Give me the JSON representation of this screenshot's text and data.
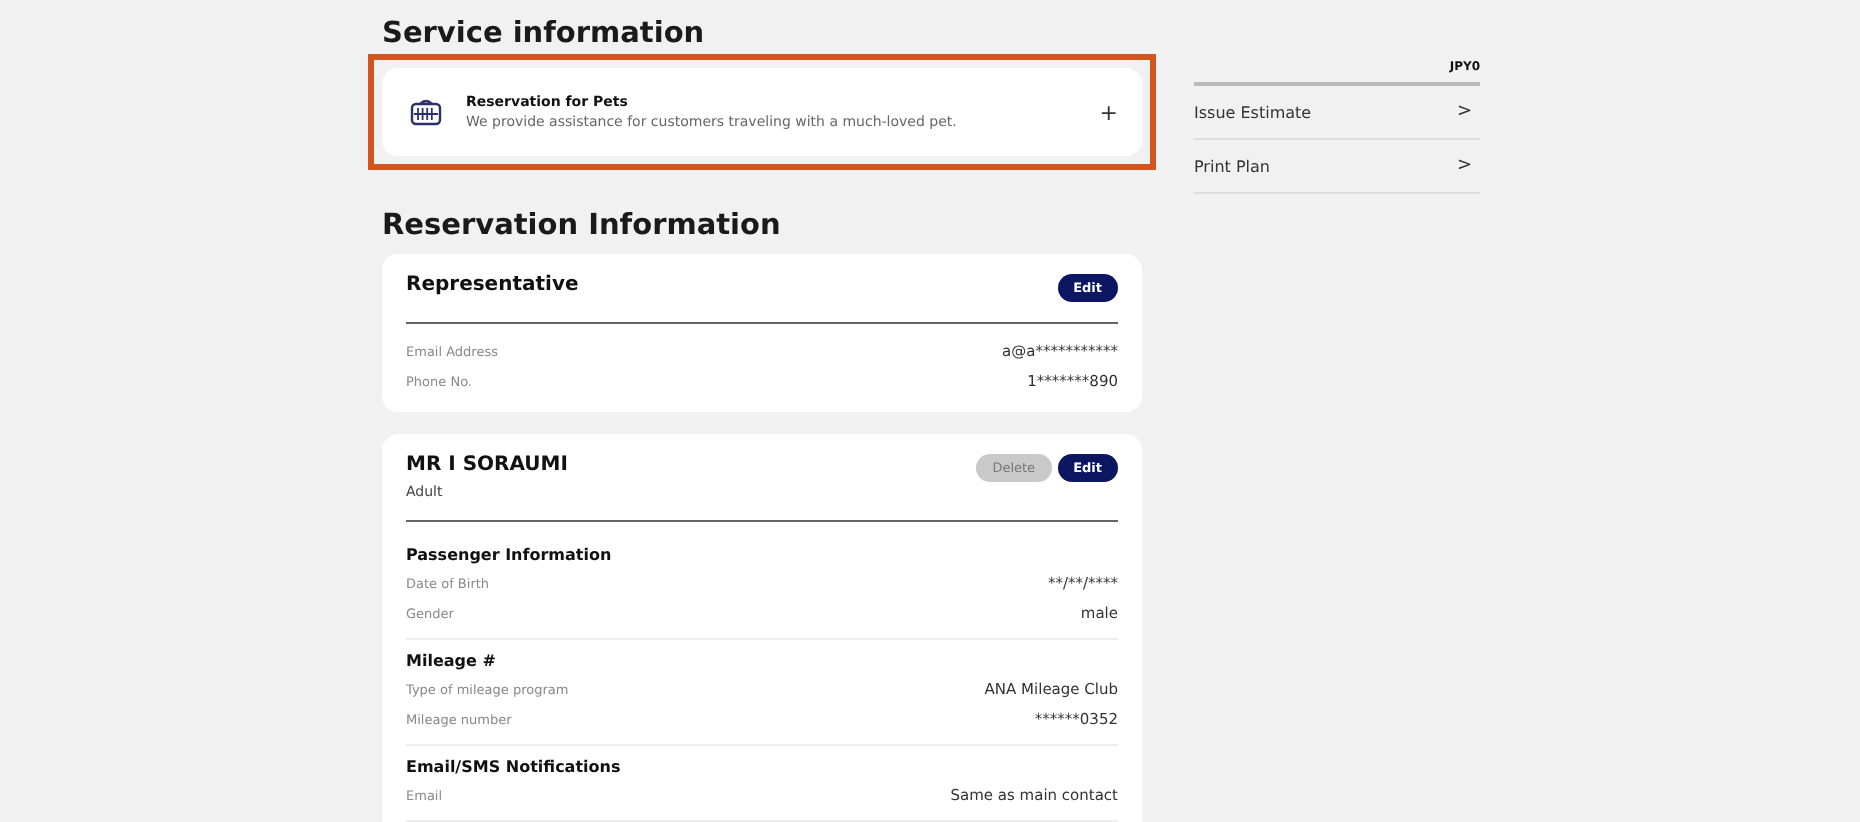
{
  "service_information": {
    "title": "Service information",
    "items": [
      {
        "title": "Reservation for Pets",
        "description": "We provide assistance for customers traveling with a much-loved pet.",
        "action": "+",
        "highlighted": true
      }
    ]
  },
  "sidebar": {
    "service_charge_value": "JPY0",
    "links": [
      {
        "label": "Issue Estimate",
        "arrow": ">"
      },
      {
        "label": "Print Plan",
        "arrow": ">"
      }
    ]
  },
  "reservation_information": {
    "title": "Reservation Information",
    "cards": [
      {
        "title": "Representative",
        "buttons": [
          {
            "kind": "edit",
            "label": "Edit"
          }
        ],
        "sections": [
          {
            "fields": [
              {
                "label": "Email Address",
                "value": "a@a***********"
              },
              {
                "label": "Phone No.",
                "value": "1*******890"
              }
            ]
          }
        ]
      },
      {
        "title": "MR I SORAUMI",
        "subtitle": "Adult",
        "buttons": [
          {
            "kind": "delete",
            "label": "Delete"
          },
          {
            "kind": "edit",
            "label": "Edit"
          }
        ],
        "sections": [
          {
            "heading": "Passenger Information",
            "fields": [
              {
                "label": "Date of Birth",
                "value": "**/**/****"
              },
              {
                "label": "Gender",
                "value": "male"
              }
            ]
          },
          {
            "heading": "Mileage #",
            "fields": [
              {
                "label": "Type of mileage program",
                "value": "ANA Mileage Club"
              },
              {
                "label": "Mileage number",
                "value": "******0352"
              }
            ]
          },
          {
            "heading": "Email/SMS Notifications",
            "fields": [
              {
                "label": "Email",
                "value": "Same as main contact"
              }
            ]
          }
        ]
      }
    ]
  }
}
